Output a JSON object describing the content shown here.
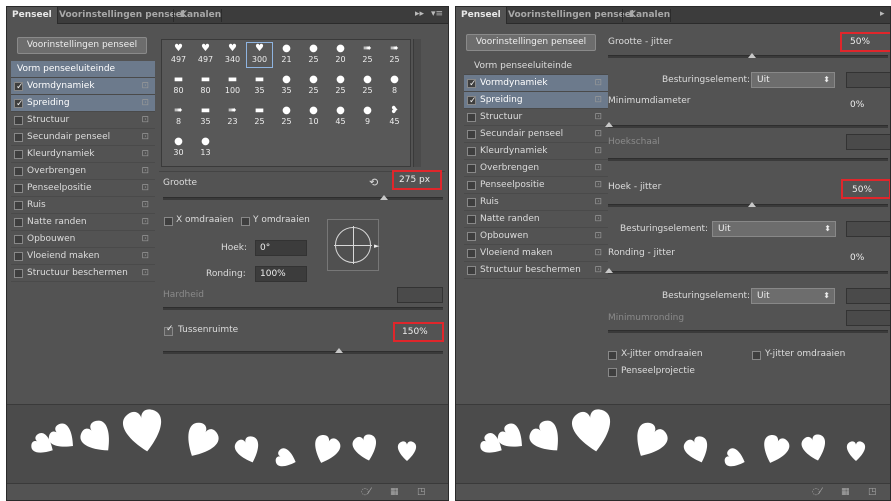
{
  "left_panel": {
    "tabs": [
      "Penseel",
      "Voorinstellingen penseel",
      "Kanalen"
    ],
    "preset_button": "Voorinstellingen penseel",
    "brush_tip_header": "Vorm penseeluiteinde",
    "settings": [
      {
        "label": "Vormdynamiek",
        "checked": true
      },
      {
        "label": "Spreiding",
        "checked": true
      },
      {
        "label": "Structuur",
        "checked": false
      },
      {
        "label": "Secundair penseel",
        "checked": false
      },
      {
        "label": "Kleurdynamiek",
        "checked": false
      },
      {
        "label": "Overbrengen",
        "checked": false
      },
      {
        "label": "Penseelpositie",
        "checked": false
      },
      {
        "label": "Ruis",
        "checked": false
      },
      {
        "label": "Natte randen",
        "checked": false
      },
      {
        "label": "Opbouwen",
        "checked": false
      },
      {
        "label": "Vloeiend maken",
        "checked": false
      },
      {
        "label": "Structuur beschermen",
        "checked": false
      }
    ],
    "brush_tiles": [
      {
        "n": "497",
        "g": "♥"
      },
      {
        "n": "497",
        "g": "♥"
      },
      {
        "n": "340",
        "g": "♥"
      },
      {
        "n": "300",
        "g": "♥",
        "selected": true
      },
      {
        "n": "21",
        "g": "●"
      },
      {
        "n": "25",
        "g": "●"
      },
      {
        "n": "20",
        "g": "●"
      },
      {
        "n": "25",
        "g": "➠"
      },
      {
        "n": "25",
        "g": "➠"
      },
      {
        "n": "80",
        "g": "▬"
      },
      {
        "n": "80",
        "g": "▬"
      },
      {
        "n": "100",
        "g": "▬"
      },
      {
        "n": "35",
        "g": "▬"
      },
      {
        "n": "35",
        "g": "●"
      },
      {
        "n": "25",
        "g": "●"
      },
      {
        "n": "25",
        "g": "●"
      },
      {
        "n": "25",
        "g": "●"
      },
      {
        "n": "8",
        "g": "●"
      },
      {
        "n": "8",
        "g": "➠"
      },
      {
        "n": "35",
        "g": "▬"
      },
      {
        "n": "23",
        "g": "➠"
      },
      {
        "n": "25",
        "g": "▬"
      },
      {
        "n": "25",
        "g": "●"
      },
      {
        "n": "10",
        "g": "●"
      },
      {
        "n": "45",
        "g": "●"
      },
      {
        "n": "9",
        "g": "●"
      },
      {
        "n": "45",
        "g": "❥"
      },
      {
        "n": "30",
        "g": "●"
      },
      {
        "n": "13",
        "g": "●"
      }
    ],
    "size_label": "Grootte",
    "size_value": "275 px",
    "flip_x": "X omdraaien",
    "flip_y": "Y omdraaien",
    "angle_label": "Hoek:",
    "angle_value": "0°",
    "roundness_label": "Ronding:",
    "roundness_value": "100%",
    "hardness_label": "Hardheid",
    "spacing_label": "Tussenruimte",
    "spacing_value": "150%"
  },
  "right_panel": {
    "tabs": [
      "Penseel",
      "Voorinstellingen penseel",
      "Kanalen"
    ],
    "preset_button": "Voorinstellingen penseel",
    "brush_tip_header": "Vorm penseeluiteinde",
    "settings": [
      {
        "label": "Vormdynamiek",
        "checked": true
      },
      {
        "label": "Spreiding",
        "checked": true
      },
      {
        "label": "Structuur",
        "checked": false
      },
      {
        "label": "Secundair penseel",
        "checked": false
      },
      {
        "label": "Kleurdynamiek",
        "checked": false
      },
      {
        "label": "Overbrengen",
        "checked": false
      },
      {
        "label": "Penseelpositie",
        "checked": false
      },
      {
        "label": "Ruis",
        "checked": false
      },
      {
        "label": "Natte randen",
        "checked": false
      },
      {
        "label": "Opbouwen",
        "checked": false
      },
      {
        "label": "Vloeiend maken",
        "checked": false
      },
      {
        "label": "Structuur beschermen",
        "checked": false
      }
    ],
    "size_jitter_label": "Grootte - jitter",
    "size_jitter_value": "50%",
    "control_label": "Besturingselement:",
    "control_value": "Uit",
    "min_diameter_label": "Minimumdiameter",
    "min_diameter_value": "0%",
    "tilt_scale_label": "Hoekschaal",
    "angle_jitter_label": "Hoek - jitter",
    "angle_jitter_value": "50%",
    "angle_control_label": "Besturingselement:",
    "angle_control_value": "Uit",
    "round_jitter_label": "Ronding - jitter",
    "round_jitter_value": "0%",
    "round_control_label": "Besturingselement:",
    "round_control_value": "Uit",
    "min_round_label": "Minimumronding",
    "flip_x_jitter": "X-jitter omdraaien",
    "flip_y_jitter": "Y-jitter omdraaien",
    "brush_projection": "Penseelprojectie"
  },
  "colors": {
    "panel": "#535353",
    "highlight_box": "#e0262b",
    "selected_row": "#6c7a8c"
  }
}
